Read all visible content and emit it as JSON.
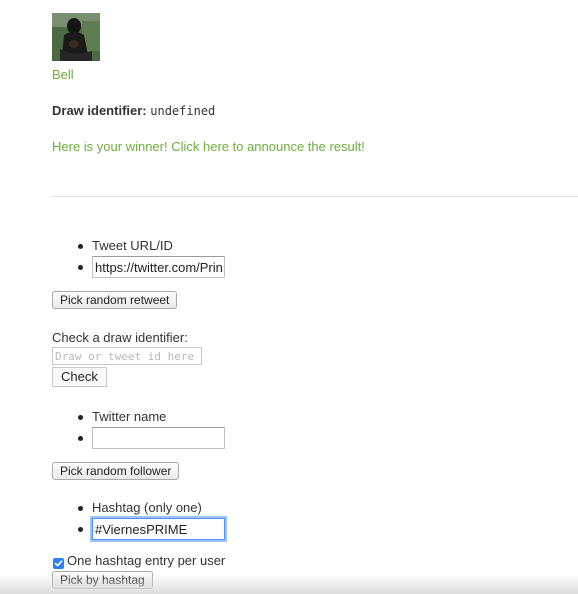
{
  "winner": {
    "name": "Bell",
    "draw_identifier_label": "Draw identifier:",
    "draw_identifier_value": "undefined",
    "announce_text": "Here is your winner! Click here to announce the result!"
  },
  "retweet": {
    "label": "Tweet URL/ID",
    "value": "https://twitter.com/Prin",
    "button": "Pick random retweet"
  },
  "check": {
    "label": "Check a draw identifier:",
    "placeholder": "Draw or tweet id here",
    "button": "Check"
  },
  "follower": {
    "label": "Twitter name",
    "value": "",
    "button": "Pick random follower"
  },
  "hashtag": {
    "label": "Hashtag (only one)",
    "value": "#ViernesPRIME",
    "one_entry_label": "One hashtag entry per user",
    "one_entry_checked": true,
    "button": "Pick by hashtag"
  },
  "colors": {
    "link": "#6fae3c",
    "focus": "#4d90fe",
    "checkbox": "#2f7ff6"
  }
}
